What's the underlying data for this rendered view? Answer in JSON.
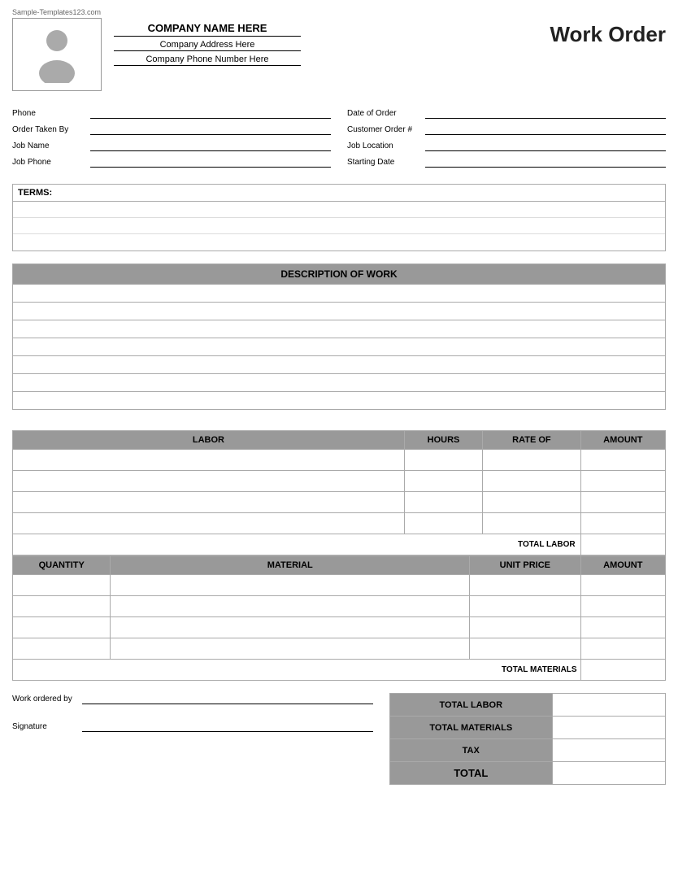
{
  "watermark": "Sample-Templates123.com",
  "header": {
    "company_name": "COMPANY NAME HERE",
    "company_address": "Company Address Here",
    "company_phone": "Company Phone Number Here",
    "title": "Work Order"
  },
  "form": {
    "left": [
      {
        "label": "Phone",
        "value": ""
      },
      {
        "label": "Order Taken By",
        "value": ""
      },
      {
        "label": "Job Name",
        "value": ""
      },
      {
        "label": "Job Phone",
        "value": ""
      }
    ],
    "right": [
      {
        "label": "Date of Order",
        "value": ""
      },
      {
        "label": "Customer Order #",
        "value": ""
      },
      {
        "label": "Job Location",
        "value": ""
      },
      {
        "label": "Starting Date",
        "value": ""
      }
    ]
  },
  "terms": {
    "label": "TERMS:",
    "rows": 3
  },
  "description": {
    "header": "DESCRIPTION OF WORK",
    "rows": 7
  },
  "labor": {
    "columns": [
      "LABOR",
      "HOURS",
      "RATE OF",
      "AMOUNT"
    ],
    "rows": 4,
    "total_label": "TOTAL LABOR"
  },
  "material": {
    "columns": [
      "QUANTITY",
      "MATERIAL",
      "UNIT PRICE",
      "AMOUNT"
    ],
    "rows": 4,
    "total_label": "TOTAL MATERIALS"
  },
  "totals": [
    {
      "label": "TOTAL LABOR",
      "value": ""
    },
    {
      "label": "TOTAL MATERIALS",
      "value": ""
    },
    {
      "label": "TAX",
      "value": ""
    },
    {
      "label": "TOTAL",
      "value": ""
    }
  ],
  "signature": {
    "work_ordered_by_label": "Work ordered by",
    "signature_label": "Signature"
  }
}
